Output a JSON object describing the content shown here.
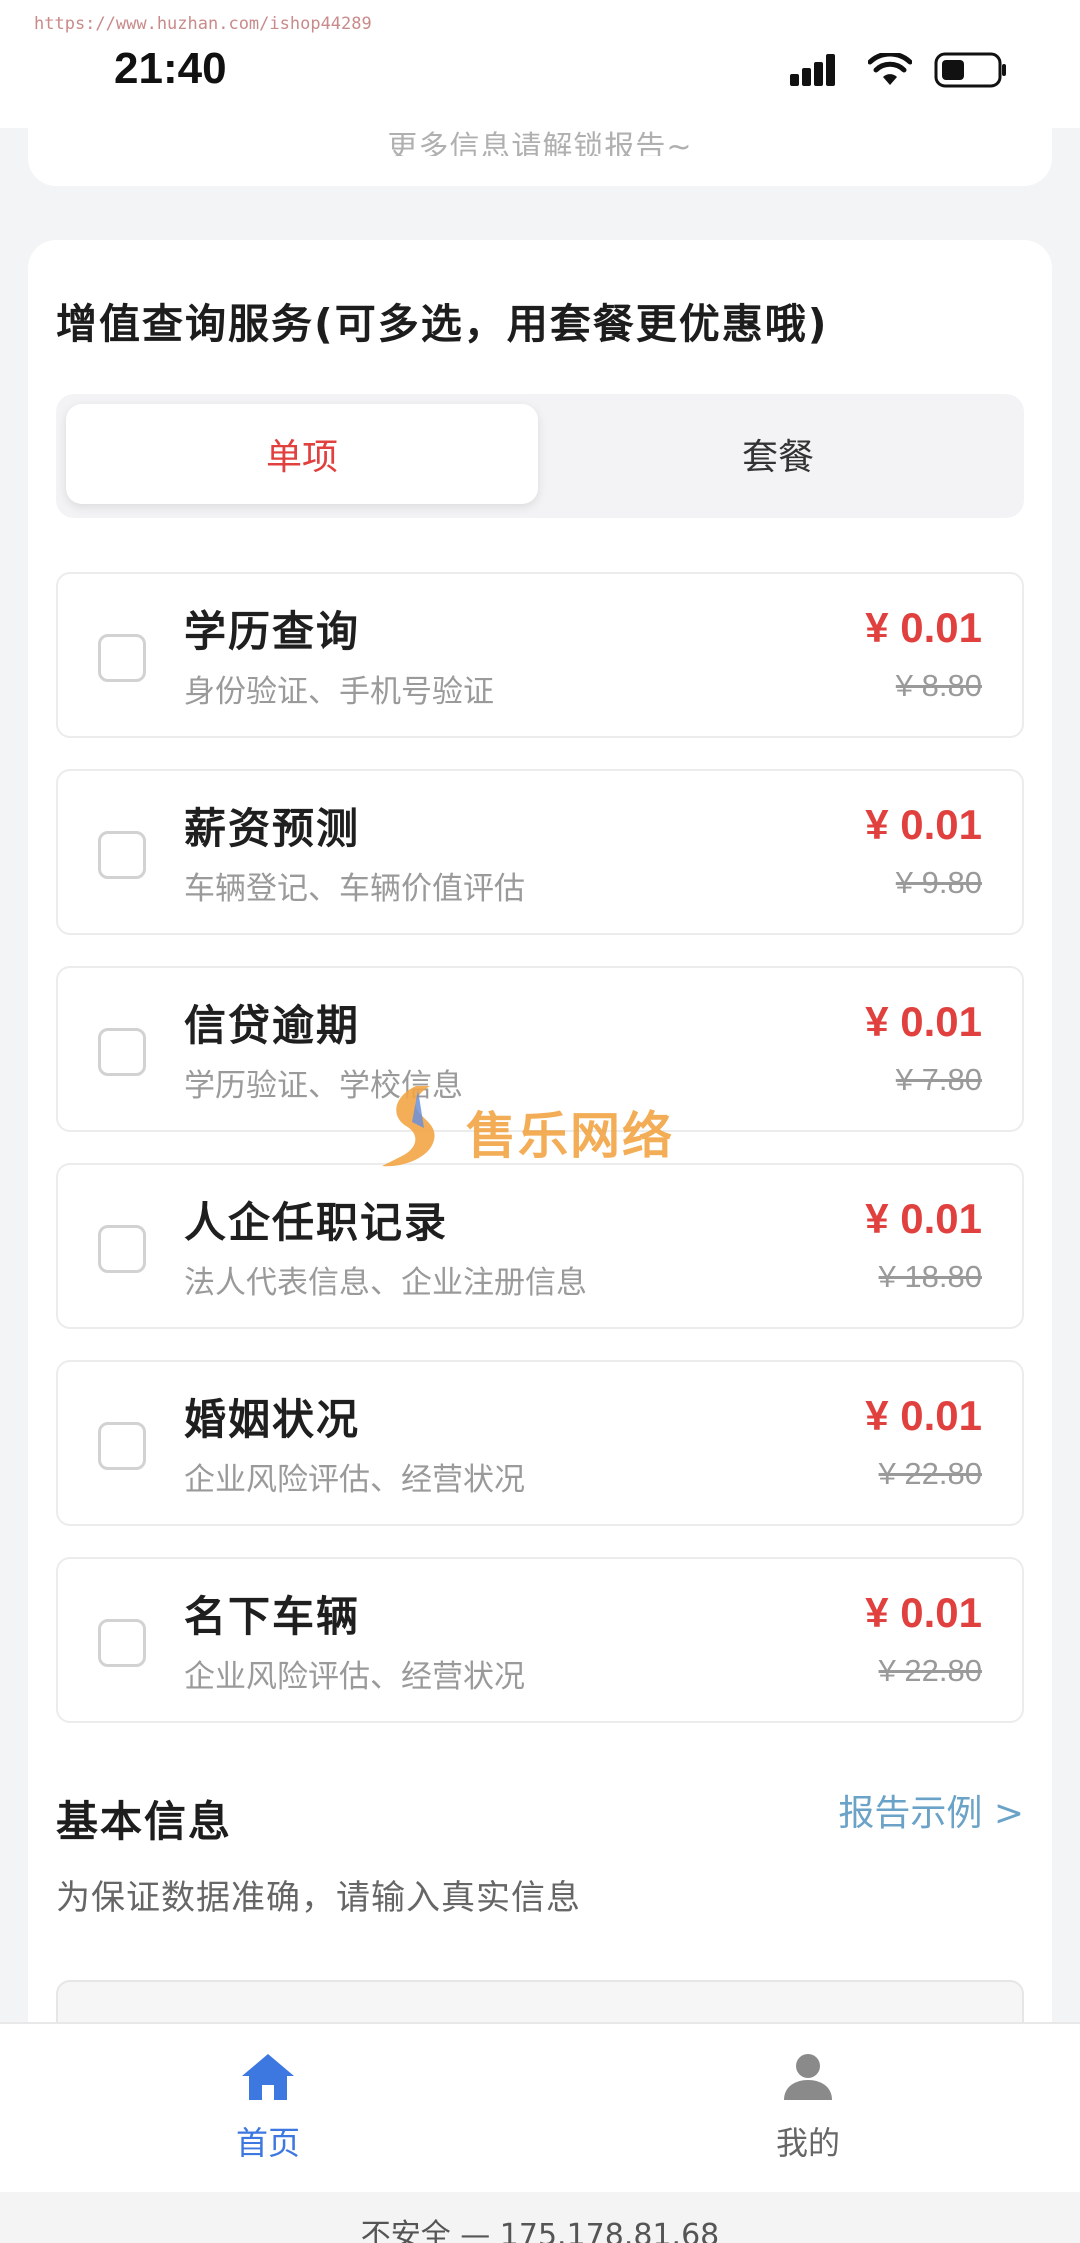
{
  "status": {
    "url": "https://www.huzhan.com/ishop44289",
    "time": "21:40"
  },
  "top_card": {
    "text": "更多信息请解锁报告~"
  },
  "services": {
    "title": "增值查询服务(可多选，用套餐更优惠哦)",
    "tabs": [
      {
        "label": "单项",
        "active": true
      },
      {
        "label": "套餐",
        "active": false
      }
    ],
    "items": [
      {
        "name": "学历查询",
        "desc": "身份验证、手机号验证",
        "price": "¥ 0.01",
        "original": "¥ 8.80"
      },
      {
        "name": "薪资预测",
        "desc": "车辆登记、车辆价值评估",
        "price": "¥ 0.01",
        "original": "¥ 9.80"
      },
      {
        "name": "信贷逾期",
        "desc": "学历验证、学校信息",
        "price": "¥ 0.01",
        "original": "¥ 7.80"
      },
      {
        "name": "人企任职记录",
        "desc": "法人代表信息、企业注册信息",
        "price": "¥ 0.01",
        "original": "¥ 18.80"
      },
      {
        "name": "婚姻状况",
        "desc": "企业风险评估、经营状况",
        "price": "¥ 0.01",
        "original": "¥ 22.80"
      },
      {
        "name": "名下车辆",
        "desc": "企业风险评估、经营状况",
        "price": "¥ 0.01",
        "original": "¥ 22.80"
      }
    ]
  },
  "basic_info": {
    "title": "基本信息",
    "link": "报告示例 >",
    "subtitle": "为保证数据准确，请输入真实信息"
  },
  "watermark": {
    "text": "售乐网络"
  },
  "bottom_nav": {
    "home_label": "首页",
    "mine_label": "我的"
  },
  "browser_bar": {
    "text": "不安全 — 175.178.81.68"
  },
  "colors": {
    "accent_red": "#e0403e",
    "link_blue": "#6aa2c8",
    "nav_active_blue": "#3d78e0",
    "watermark_orange": "#f2a545"
  },
  "icons": [
    "signal-icon",
    "wifi-icon",
    "battery-icon",
    "home-icon",
    "user-icon",
    "watermark-logo"
  ]
}
